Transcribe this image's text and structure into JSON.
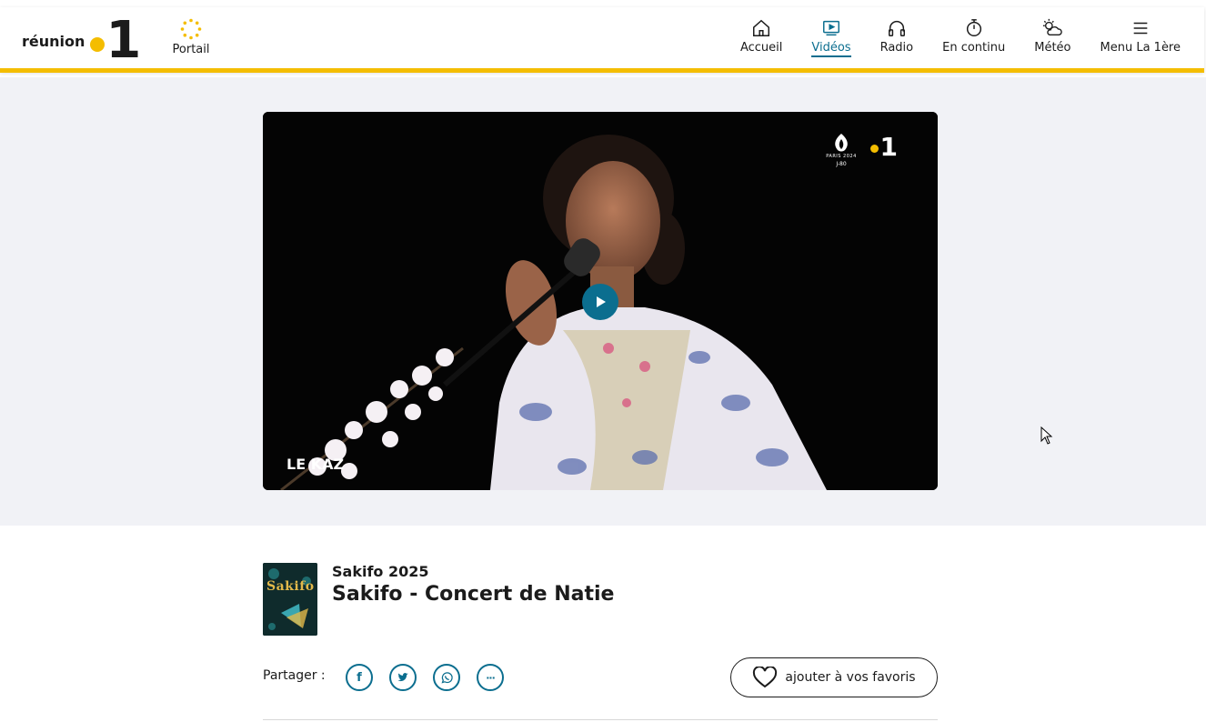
{
  "header": {
    "logo": {
      "text": "réunion",
      "number": "1",
      "dot_color": "#f4bd00"
    },
    "portail": {
      "label": "Portail",
      "icon": "portail-dots-icon"
    },
    "nav": [
      {
        "label": "Accueil",
        "icon": "home-icon",
        "active": false
      },
      {
        "label": "Vidéos",
        "icon": "video-icon",
        "active": true
      },
      {
        "label": "Radio",
        "icon": "headphones-icon",
        "active": false
      },
      {
        "label": "En continu",
        "icon": "stopwatch-icon",
        "active": false
      },
      {
        "label": "Météo",
        "icon": "weather-icon",
        "active": false
      },
      {
        "label": "Menu La 1ère",
        "icon": "menu-icon",
        "active": false
      }
    ]
  },
  "player": {
    "overlay_logo_number": "1",
    "paris_logo_text": "PARIS 2024",
    "paris_logo_sub": "J-80",
    "corner_brand": "LE KAZ",
    "play_icon": "play-icon"
  },
  "content": {
    "show_name": "Sakifo 2025",
    "title": "Sakifo - Concert de Natie",
    "thumbnail_text": "Sakifo"
  },
  "share": {
    "label": "Partager :",
    "buttons": [
      {
        "icon": "facebook-icon",
        "glyph": "f"
      },
      {
        "icon": "twitter-icon",
        "glyph": ""
      },
      {
        "icon": "whatsapp-icon",
        "glyph": ""
      },
      {
        "icon": "more-icon",
        "glyph": "···"
      }
    ],
    "favorite_label": "ajouter à vos favoris",
    "favorite_icon": "heart-icon"
  },
  "colors": {
    "accent": "#0b6e8f",
    "brand_yellow": "#f4bd00",
    "band_bg": "#f1f2f6"
  }
}
